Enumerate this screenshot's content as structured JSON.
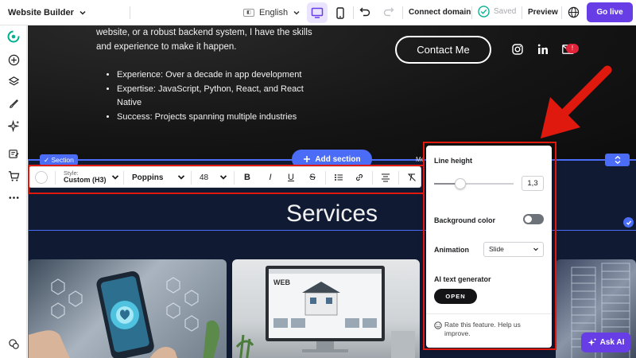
{
  "topbar": {
    "app_title": "Website Builder",
    "language": "English",
    "connect_domain": "Connect domain",
    "saved": "Saved",
    "preview": "Preview",
    "go_live": "Go live"
  },
  "hero": {
    "line1": "website, or a robust backend system, I have the skills",
    "line2": "and experience to make it happen.",
    "bullets": [
      "Experience: Over a decade in app development",
      "Expertise: JavaScript, Python, React, and React",
      "Native",
      "Success: Projects spanning multiple industries"
    ],
    "contact_button": "Contact Me",
    "notification": "!"
  },
  "section_tag": "Section",
  "add_section": "Add section",
  "mo_label": "Mo",
  "toolbar": {
    "style_label": "Style:",
    "style_value": "Custom (H3)",
    "font": "Poppins",
    "size": "48"
  },
  "services_title": "Services",
  "popover": {
    "line_height_label": "Line height",
    "line_height_value": "1,3",
    "line_height_slider_fraction": 0.33,
    "background_color_label": "Background color",
    "background_color_enabled": false,
    "animation_label": "Animation",
    "animation_value": "Slide",
    "ai_text_label": "AI text generator",
    "open_button": "OPEN",
    "rate_text": "Rate this feature. Help us improve."
  },
  "ask_ai": "Ask AI",
  "colors": {
    "accent": "#673de6",
    "selection": "#4a6cf7",
    "annotation_red": "#e0190f"
  }
}
